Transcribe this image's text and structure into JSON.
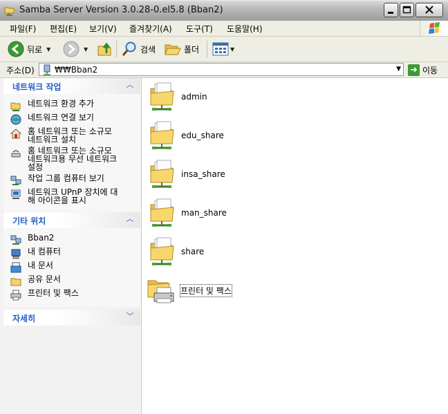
{
  "window": {
    "title": "Samba Server Version 3.0.28-0.el5.8 (Bban2)"
  },
  "menu": [
    {
      "label": "파일(F)"
    },
    {
      "label": "편집(E)"
    },
    {
      "label": "보기(V)"
    },
    {
      "label": "즐겨찾기(A)"
    },
    {
      "label": "도구(T)"
    },
    {
      "label": "도움말(H)"
    }
  ],
  "toolbar": {
    "back_label": "뒤로",
    "search_label": "검색",
    "folders_label": "폴더"
  },
  "address": {
    "label": "주소(D)",
    "value": "₩₩Bban2",
    "go_label": "이동"
  },
  "left_panels": {
    "network_tasks": {
      "title": "네트워크 작업",
      "items": [
        {
          "label": "네트워크 환경 추가",
          "icon": "add-network-place-icon"
        },
        {
          "label": "네트워크 연결 보기",
          "icon": "network-connections-icon"
        },
        {
          "label": "홈 네트워크 또는 소규모\n네트워크 설치",
          "icon": "home-network-icon"
        },
        {
          "label": "홈 네트워크 또는 소규모\n네트워크용 무선 네트워크\n설정",
          "icon": "wireless-network-icon"
        },
        {
          "label": "작업 그룹 컴퓨터 보기",
          "icon": "workgroup-icon"
        },
        {
          "label": "네트워크 UPnP 장치에 대\n해 아이콘을 표시",
          "icon": "upnp-device-icon"
        }
      ]
    },
    "other_places": {
      "title": "기타 위치",
      "items": [
        {
          "label": "Bban2",
          "icon": "network-computer-icon"
        },
        {
          "label": "내 컴퓨터",
          "icon": "my-computer-icon"
        },
        {
          "label": "내 문서",
          "icon": "my-documents-icon"
        },
        {
          "label": "공유 문서",
          "icon": "shared-documents-icon"
        },
        {
          "label": "프린터 및 팩스",
          "icon": "printer-icon"
        }
      ]
    },
    "details": {
      "title": "자세히"
    }
  },
  "files": [
    {
      "name": "admin",
      "icon": "shared-folder-icon"
    },
    {
      "name": "edu_share",
      "icon": "shared-folder-icon"
    },
    {
      "name": "insa_share",
      "icon": "shared-folder-icon"
    },
    {
      "name": "man_share",
      "icon": "shared-folder-icon"
    },
    {
      "name": "share",
      "icon": "shared-folder-icon"
    },
    {
      "name": "프린터 및 팩스",
      "icon": "printer-folder-icon"
    }
  ],
  "colors": {
    "panel_header_text": "#215dc6",
    "toolbar_bg": "#efeee4",
    "folder_yellow": "#f4d16b"
  }
}
